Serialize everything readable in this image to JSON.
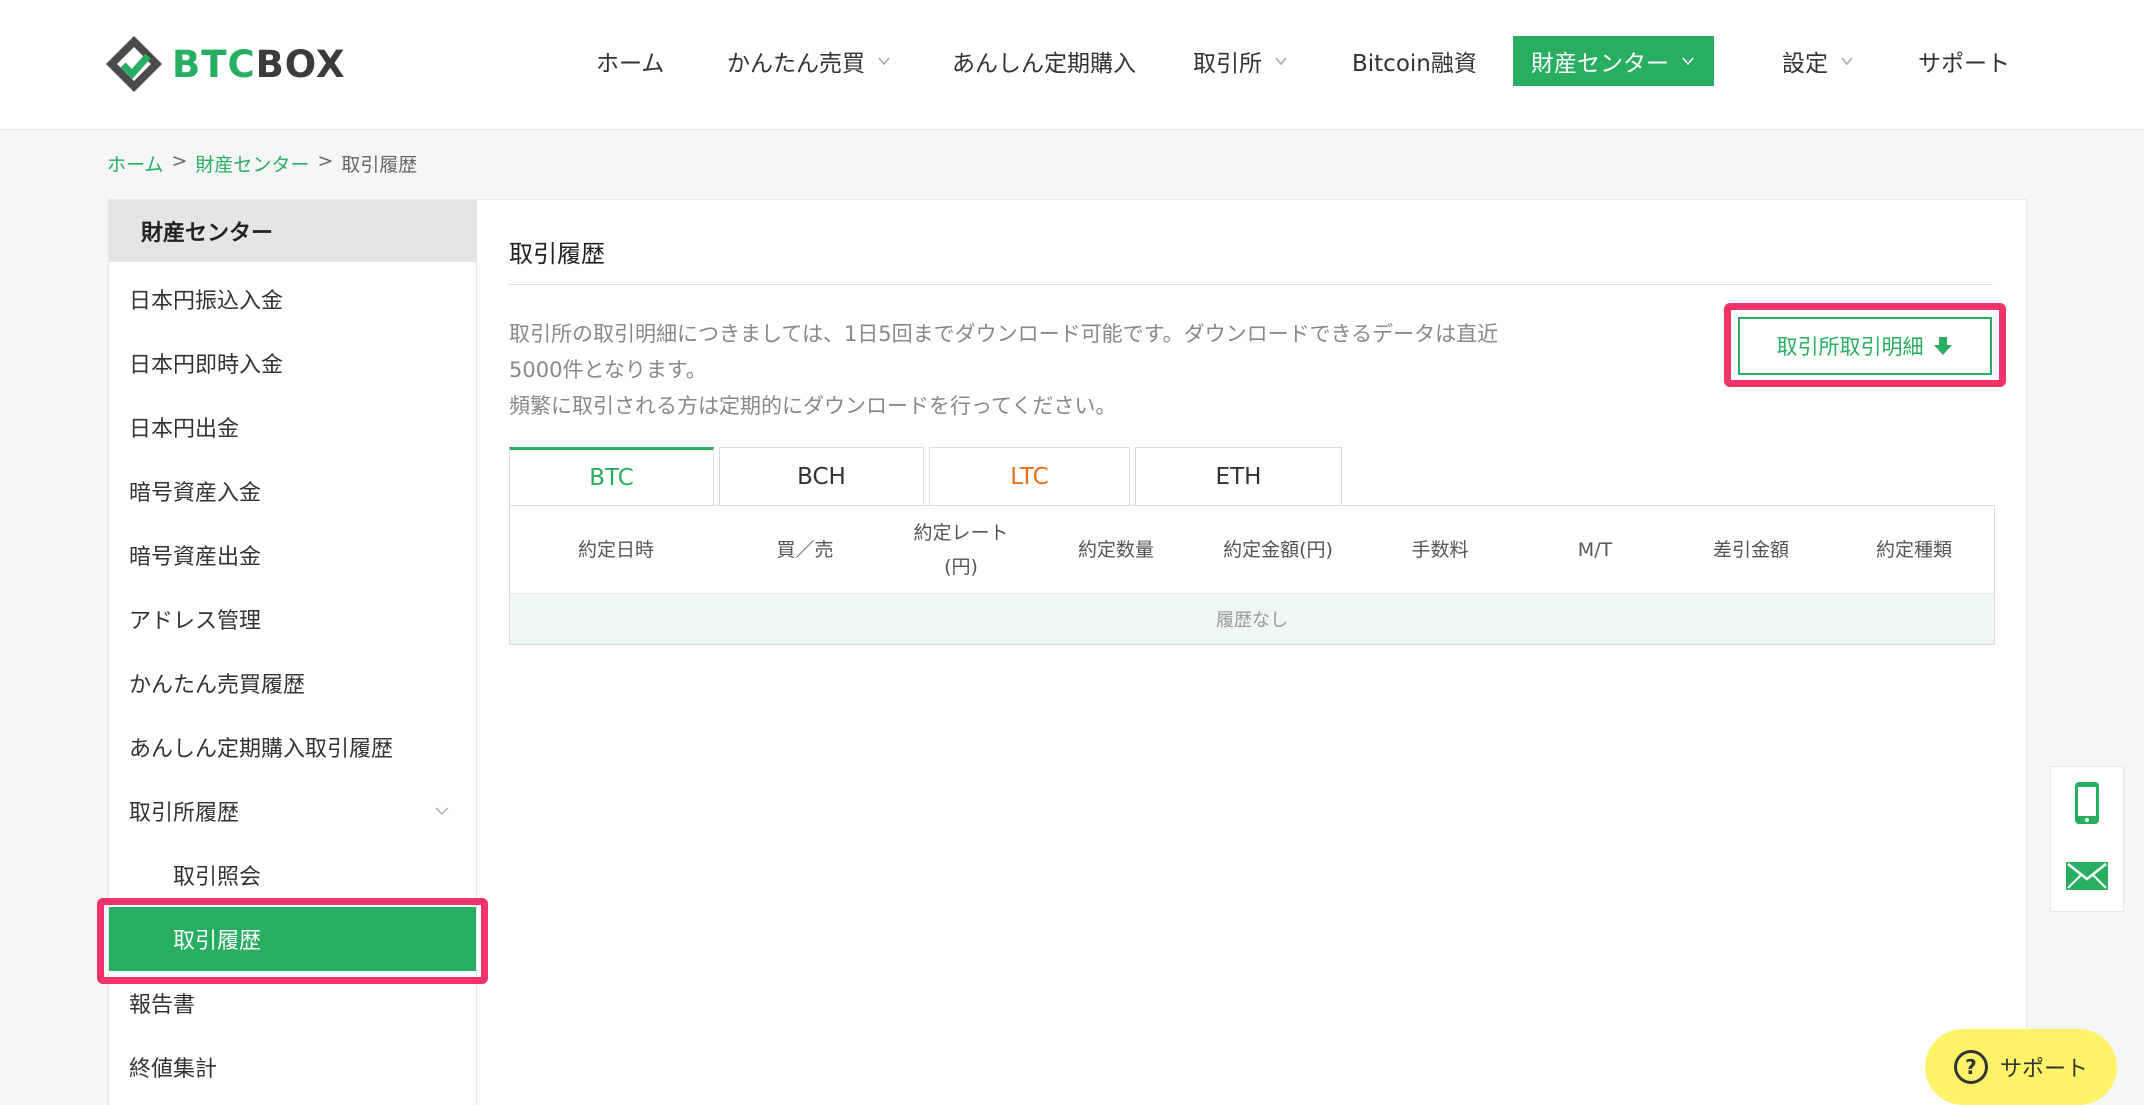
{
  "brand": {
    "part1": "BTC",
    "part2": "BOX"
  },
  "nav": {
    "items": [
      {
        "label": "ホーム"
      },
      {
        "label": "かんたん売買"
      },
      {
        "label": "あんしん定期購入"
      },
      {
        "label": "取引所"
      },
      {
        "label": "Bitcoin融資"
      },
      {
        "label": "財産センター"
      },
      {
        "label": "設定"
      },
      {
        "label": "サポート"
      }
    ]
  },
  "breadcrumb": {
    "home": "ホーム",
    "sep1": ">",
    "center": "財産センター",
    "sep2": ">",
    "current": "取引履歴"
  },
  "sidebar": {
    "title": "財産センター",
    "items": [
      {
        "label": "日本円振込入金"
      },
      {
        "label": "日本円即時入金"
      },
      {
        "label": "日本円出金"
      },
      {
        "label": "暗号資産入金"
      },
      {
        "label": "暗号資産出金"
      },
      {
        "label": "アドレス管理"
      },
      {
        "label": "かんたん売買履歴"
      },
      {
        "label": "あんしん定期購入取引履歴"
      },
      {
        "label": "取引所履歴"
      },
      {
        "label": "取引照会"
      },
      {
        "label": "取引履歴"
      },
      {
        "label": "報告書"
      },
      {
        "label": "終値集計"
      }
    ]
  },
  "content": {
    "title": "取引履歴",
    "note_line1": "取引所の取引明細につきましては、1日5回までダウンロード可能です。ダウンロードできるデータは直近",
    "note_line2": "5000件となります。",
    "note_line3": "頻繁に取引される方は定期的にダウンロードを行ってください。",
    "download_button": "取引所取引明細",
    "tabs": [
      {
        "label": "BTC"
      },
      {
        "label": "BCH"
      },
      {
        "label": "LTC"
      },
      {
        "label": "ETH"
      }
    ],
    "table": {
      "headers": [
        "約定日時",
        "買／売",
        "約定レート(円)",
        "約定数量",
        "約定金額(円)",
        "手数料",
        "M/T",
        "差引金額",
        "約定種類"
      ],
      "rate_line1": "約定レート",
      "rate_line2": "(円)",
      "empty": "履歴なし"
    }
  },
  "support": {
    "label": "サポート",
    "q": "?"
  },
  "colors": {
    "accent": "#27ae60",
    "highlight": "#f0336a",
    "ltc": "#e8701a",
    "support_bg": "#fff36a"
  }
}
